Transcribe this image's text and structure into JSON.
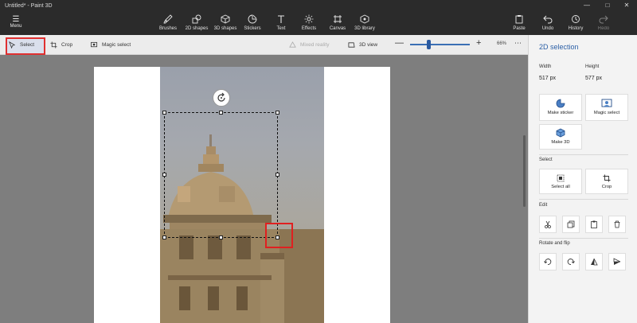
{
  "window": {
    "title": "Untitled* - Paint 3D",
    "controls": [
      "—",
      "□",
      "✕"
    ]
  },
  "menu": {
    "label": "Menu"
  },
  "tools": [
    {
      "label": "Brushes",
      "icon": "brush-icon"
    },
    {
      "label": "2D shapes",
      "icon": "2d-shapes-icon"
    },
    {
      "label": "3D shapes",
      "icon": "3d-shapes-icon"
    },
    {
      "label": "Stickers",
      "icon": "stickers-icon"
    },
    {
      "label": "Text",
      "icon": "text-icon"
    },
    {
      "label": "Effects",
      "icon": "effects-icon"
    },
    {
      "label": "Canvas",
      "icon": "canvas-icon"
    },
    {
      "label": "3D library",
      "icon": "3d-library-icon"
    }
  ],
  "right_tools": [
    {
      "label": "Paste",
      "icon": "paste-icon"
    },
    {
      "label": "Undo",
      "icon": "undo-icon"
    },
    {
      "label": "History",
      "icon": "history-icon"
    },
    {
      "label": "Redo",
      "icon": "redo-icon"
    }
  ],
  "subtoolbar": {
    "select": "Select",
    "crop": "Crop",
    "magic_select": "Magic select",
    "mixed_reality": "Mixed reality",
    "view_3d": "3D view",
    "zoom_percent": "66%",
    "more": "⋯",
    "zoom_out": "—",
    "zoom_in": "+"
  },
  "zoom": {
    "level": 66
  },
  "panel": {
    "title": "2D selection",
    "width_label": "Width",
    "width_value": "517 px",
    "height_label": "Height",
    "height_value": "577 px",
    "make_sticker": "Make sticker",
    "magic_select": "Magic select",
    "make_3d": "Make 3D",
    "select_section": "Select",
    "select_all": "Select all",
    "crop": "Crop",
    "edit_section": "Edit",
    "rotate_flip_section": "Rotate and flip"
  },
  "colors": {
    "accent": "#2b5fa6",
    "highlight": "#e03030",
    "header": "#2b2b2b"
  }
}
